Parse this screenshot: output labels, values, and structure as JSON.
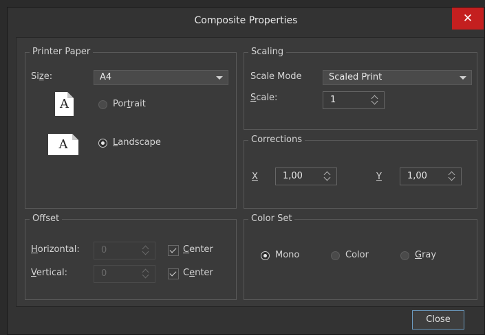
{
  "window": {
    "title": "Composite Properties"
  },
  "printer_paper": {
    "legend": "Printer Paper",
    "size_label": "Size:",
    "size_value": "A4",
    "portrait_label": "Portrait",
    "landscape_label": "Landscape",
    "orientation_selected": "landscape",
    "paper_glyph": "A"
  },
  "scaling": {
    "legend": "Scaling",
    "scale_mode_label": "Scale Mode",
    "scale_mode_value": "Scaled Print",
    "scale_label": "Scale:",
    "scale_value": "1"
  },
  "corrections": {
    "legend": "Corrections",
    "x_label": "X",
    "x_value": "1,00",
    "y_label": "Y",
    "y_value": "1,00"
  },
  "offset": {
    "legend": "Offset",
    "horizontal_label": "Horizontal:",
    "horizontal_value": "0",
    "horizontal_center_label": "Center",
    "vertical_label": "Vertical:",
    "vertical_value": "0",
    "vertical_center_label": "Center"
  },
  "color_set": {
    "legend": "Color Set",
    "mono_label": "Mono",
    "color_label": "Color",
    "gray_label": "Gray",
    "selected": "mono"
  },
  "footer": {
    "close_label": "Close"
  },
  "colors": {
    "close_red": "#c41f1f",
    "focus_blue": "#6c9bc0"
  },
  "icons": {
    "close": "close-icon",
    "dropdown": "chevron-down-icon",
    "spinner": "spinner-icon"
  }
}
